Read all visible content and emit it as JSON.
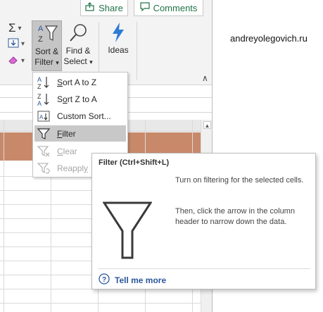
{
  "header": {
    "share_label": "Share",
    "comments_label": "Comments",
    "share_icon": "share-icon",
    "comments_icon": "comment-icon"
  },
  "ribbon": {
    "sort_filter": {
      "line1": "Sort &",
      "line2": "Filter",
      "dropdown_icon": "chevron-down-icon"
    },
    "find_select": {
      "line1": "Find &",
      "line2": "Select",
      "dropdown_icon": "chevron-down-icon"
    },
    "ideas": {
      "label": "Ideas"
    },
    "small_buttons": [
      "autosum-icon",
      "fill-down-icon",
      "clear-eraser-icon"
    ],
    "collapse_icon": "chevron-up-icon"
  },
  "sort_filter_menu": {
    "items": [
      {
        "label": "Sort A to Z",
        "mnemonic": "S",
        "icon": "sort-a-to-z-icon",
        "state": "enabled"
      },
      {
        "label": "Sort Z to A",
        "mnemonic": "o",
        "icon": "sort-z-to-a-icon",
        "state": "enabled"
      },
      {
        "label": "Custom Sort...",
        "mnemonic": "U",
        "icon": "custom-sort-icon",
        "state": "enabled"
      },
      {
        "label": "Filter",
        "mnemonic": "F",
        "icon": "filter-icon",
        "state": "highlighted"
      },
      {
        "label": "Clear",
        "mnemonic": "C",
        "icon": "clear-filter-icon",
        "state": "disabled"
      },
      {
        "label": "Reapply",
        "mnemonic": "y",
        "icon": "reapply-filter-icon",
        "state": "disabled"
      }
    ]
  },
  "tooltip": {
    "title": "Filter (Ctrl+Shift+L)",
    "description1": "Turn on filtering for the selected cells.",
    "description2": "Then, click the arrow in the column header to narrow down the data.",
    "help_link": "Tell me more",
    "help_icon": "help-question-icon"
  },
  "watermark": {
    "text": "andreyolegovich.ru"
  },
  "colors": {
    "excel_green": "#217346",
    "row_fill_brown": "#c8896b",
    "menu_highlight": "#c8c8c8",
    "ideas_blue": "#2e7bd6",
    "link_blue": "#2b579a"
  }
}
